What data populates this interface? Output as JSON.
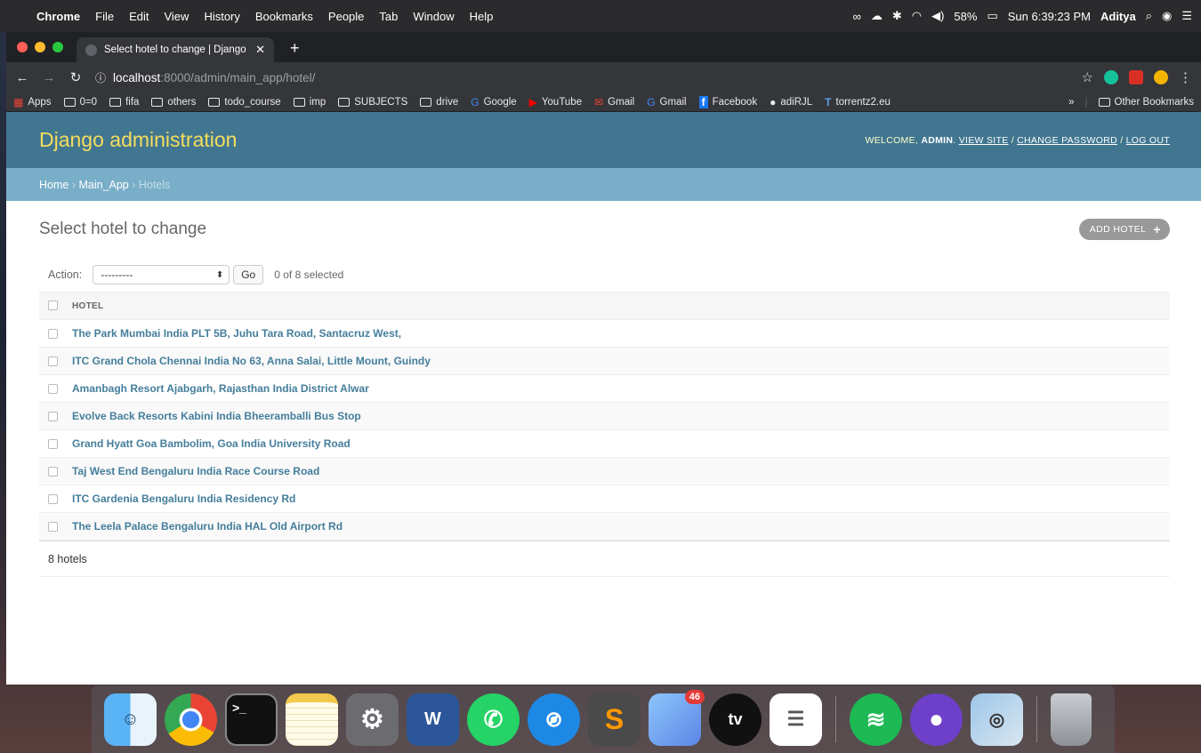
{
  "menubar": {
    "app_name": "Chrome",
    "menus": [
      "File",
      "Edit",
      "View",
      "History",
      "Bookmarks",
      "People",
      "Tab",
      "Window",
      "Help"
    ],
    "battery": "58%",
    "clock": "Sun 6:39:23 PM",
    "user": "Aditya"
  },
  "browser": {
    "tab_title": "Select hotel to change | Django site admin",
    "url_host": "localhost",
    "url_path": ":8000/admin/main_app/hotel/",
    "bookmarks": [
      {
        "label": "Apps",
        "icon": "apps-grid-icon"
      },
      {
        "label": "0=0",
        "icon": "folder-icon"
      },
      {
        "label": "fifa",
        "icon": "folder-icon"
      },
      {
        "label": "others",
        "icon": "folder-icon"
      },
      {
        "label": "todo_course",
        "icon": "folder-icon"
      },
      {
        "label": "imp",
        "icon": "folder-icon"
      },
      {
        "label": "SUBJECTS",
        "icon": "folder-icon"
      },
      {
        "label": "drive",
        "icon": "folder-icon"
      },
      {
        "label": "Google",
        "icon": "google-icon"
      },
      {
        "label": "YouTube",
        "icon": "youtube-icon"
      },
      {
        "label": "Gmail",
        "icon": "gmail-icon"
      },
      {
        "label": "Gmail",
        "icon": "google-icon"
      },
      {
        "label": "Facebook",
        "icon": "facebook-icon"
      },
      {
        "label": "adiRJL",
        "icon": "github-icon"
      },
      {
        "label": "torrentz2.eu",
        "icon": "torrentz-icon"
      }
    ],
    "bookmarks_more": "»",
    "other_bookmarks": "Other Bookmarks"
  },
  "admin": {
    "branding": "Django administration",
    "welcome": "Welcome,",
    "username": "admin",
    "view_site": "View site",
    "change_password": "Change password",
    "log_out": "Log out",
    "breadcrumbs": {
      "home": "Home",
      "app": "Main_App",
      "current": "Hotels"
    },
    "page_title": "Select hotel to change",
    "add_button": "ADD HOTEL",
    "action_label": "Action:",
    "action_selected": "---------",
    "go_button": "Go",
    "selection_count": "0 of 8 selected",
    "column_header": "HOTEL",
    "hotels": [
      "The Park Mumbai India PLT 5B, Juhu Tara Road, Santacruz West,",
      "ITC Grand Chola Chennai India No 63, Anna Salai, Little Mount, Guindy",
      "Amanbagh Resort Ajabgarh, Rajasthan India District Alwar",
      "Evolve Back Resorts Kabini India Bheeramballi Bus Stop",
      "Grand Hyatt Goa Bambolim, Goa India University Road",
      "Taj West End Bengaluru India Race Course Road",
      "ITC Gardenia Bengaluru India Residency Rd",
      "The Leela Palace Bengaluru India HAL Old Airport Rd"
    ],
    "paginator": "8 hotels"
  },
  "dock": {
    "notes_badge": "46",
    "apps": [
      "finder",
      "chrome",
      "terminal",
      "notes",
      "system-preferences",
      "word",
      "whatsapp",
      "safari",
      "sublime-text",
      "preview",
      "apple-tv",
      "reminders",
      "spotify",
      "github-desktop",
      "image-capture",
      "trash"
    ]
  },
  "colors": {
    "django_header": "#417690",
    "django_breadcrumb": "#79aec8",
    "django_branding": "#f5dd5d",
    "link": "#447e9b"
  }
}
